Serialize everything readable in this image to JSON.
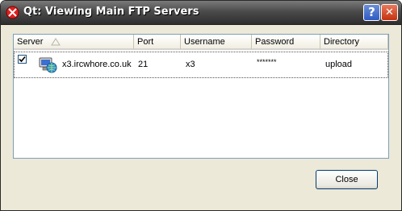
{
  "window": {
    "title": "Qt: Viewing Main FTP Servers"
  },
  "titlebar": {
    "help_label": "?",
    "close_label": "✕"
  },
  "table": {
    "columns": [
      "Server",
      "Port",
      "Username",
      "Password",
      "Directory"
    ],
    "sort_column": "Server",
    "sort_direction": "ascending",
    "rows": [
      {
        "checked": true,
        "server": "x3.ircwhore.co.uk",
        "port": "21",
        "username": "x3",
        "password": "*******",
        "directory": "upload"
      }
    ]
  },
  "buttons": {
    "close_label": "Close"
  },
  "icons": {
    "app": "qt-app-icon",
    "server": "network-computer-icon"
  }
}
